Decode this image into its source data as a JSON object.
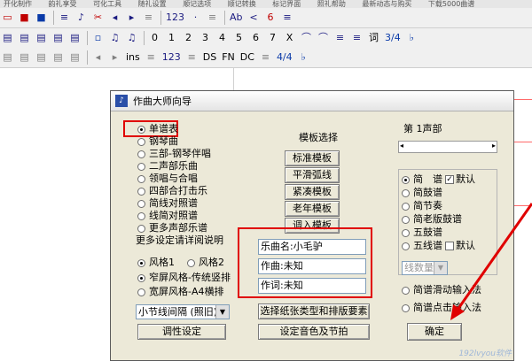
{
  "menubar": {
    "items": [
      "开化制作",
      "韵礼享受",
      "可化工具",
      "随礼设置",
      "顺记选项",
      "顺记转换",
      "标记界面",
      "照礼帮助",
      "最新动态与购买",
      "下载5000曲谱"
    ]
  },
  "toolbar1": [
    "▭",
    "■",
    "■",
    "≡",
    "♪",
    "✂",
    "◂",
    "▸",
    "≡",
    "123",
    "·",
    "≡",
    "Ab",
    "<",
    "6",
    "≡"
  ],
  "toolbar2": [
    "▤",
    "▤",
    "▤",
    "▤",
    "▤",
    "▫",
    "♫",
    "♫",
    "0",
    "1",
    "2",
    "3",
    "4",
    "5",
    "6",
    "7",
    "X",
    "⌒",
    "⌒",
    "≡",
    "≡",
    "词",
    "3/4",
    "♭"
  ],
  "toolbar3": [
    "▤",
    "▤",
    "▤",
    "▤",
    "▤",
    "◂",
    "▸",
    "ins",
    "≡",
    "123",
    "≡",
    "DS",
    "FN",
    "DC",
    "≡",
    "4/4",
    "♭"
  ],
  "dialog": {
    "title": "作曲大师向导",
    "score_types": [
      "单谱表",
      "钢琴曲",
      "三部-钢琴伴唱",
      "二声部乐曲",
      "领唱与合唱",
      "四部合打击乐",
      "简线对照谱",
      "线简对照谱",
      "更多声部乐谱"
    ],
    "more_settings": "更多设定请详阅说明",
    "styles": [
      "风格1",
      "风格2"
    ],
    "widths": [
      "窄屏风格-传统竖排",
      "宽屏风格-A4横排"
    ],
    "barline_select": "小节线间隔 (照旧)",
    "personal_btn": "调性设定",
    "template_label": "模板选择",
    "templates": [
      "标准模板",
      "平滑弧线",
      "紧凑模板",
      "老年模板",
      "调入模板"
    ],
    "song_name": "乐曲名:小毛驴",
    "composer": "作曲:未知",
    "lyricist": "作词:未知",
    "paper_btn": "选择纸张类型和排版要素",
    "color_btn": "设定音色及节拍",
    "part_label": "第 1声部",
    "notation_types": [
      "简　谱",
      "简鼓谱",
      "简节奏",
      "简老版鼓谱",
      "五鼓谱",
      "五线谱"
    ],
    "default_label": "默认",
    "line_count_select": "线数量",
    "input_modes": [
      "简谱滑动输入法",
      "简谱点击输入法"
    ],
    "ok_btn": "确定",
    "watermark": "192lvyou软件"
  },
  "colors": {
    "highlight": "#e00000",
    "dialog_bg": "#ece9d8"
  }
}
